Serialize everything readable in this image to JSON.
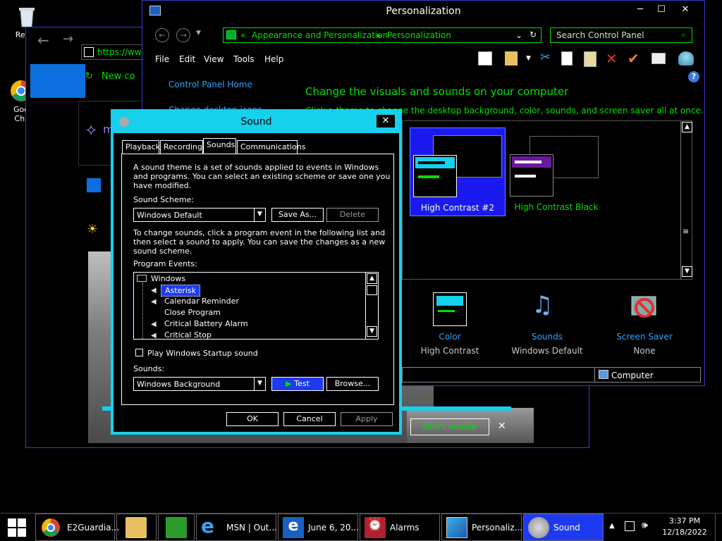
{
  "desktop": {
    "icons": [
      {
        "label": "Recyc",
        "icon": "recycle-bin-icon"
      },
      {
        "label": "Goo\nChr",
        "icon": "chrome-icon"
      }
    ]
  },
  "browser": {
    "url": "https://ww",
    "new_label": "New co",
    "bing_letter": "m",
    "dont_enable": "Don't enable",
    "close_glyph": "✕"
  },
  "personalization": {
    "title": "Personalization",
    "breadcrumb": [
      "Appearance and Personalization",
      "Personalization"
    ],
    "search_placeholder": "Search Control Panel",
    "menu": [
      "File",
      "Edit",
      "View",
      "Tools",
      "Help"
    ],
    "sidebar": {
      "home": "Control Panel Home",
      "desktop_icons": "Change desktop icons"
    },
    "heading": "Change the visuals and sounds on your computer",
    "subheading": "Click a theme to change the desktop background, color, sounds, and screen saver all at once.",
    "themes": [
      {
        "name": "High Contrast #2",
        "selected": true
      },
      {
        "name": "High Contrast Black",
        "selected": false
      }
    ],
    "bottom_items": [
      {
        "label": "Color",
        "value": "High Contrast",
        "icon": "color-icon"
      },
      {
        "label": "Sounds",
        "value": "Windows Default",
        "icon": "sounds-icon"
      },
      {
        "label": "Screen Saver",
        "value": "None",
        "icon": "screen-saver-icon"
      }
    ],
    "status": "Computer",
    "help_glyph": "?"
  },
  "sound": {
    "title": "Sound",
    "tabs": [
      "Playback",
      "Recording",
      "Sounds",
      "Communications"
    ],
    "active_tab": "Sounds",
    "intro": [
      "A sound theme is a set of sounds applied to events in Windows",
      "and programs.  You can select an existing scheme or save one you",
      "have modified."
    ],
    "scheme_label": "Sound Scheme:",
    "scheme_value": "Windows Default",
    "save_as": "Save As...",
    "delete": "Delete",
    "instructions": [
      "To change sounds, click a program event in the following list and",
      "then select a sound to apply.  You can save the changes as a new",
      "sound scheme."
    ],
    "events_label": "Program Events:",
    "events_group": "Windows",
    "events": [
      {
        "name": "Asterisk",
        "selected": true,
        "has_sound": true
      },
      {
        "name": "Calendar Reminder",
        "selected": false,
        "has_sound": true
      },
      {
        "name": "Close Program",
        "selected": false,
        "has_sound": false
      },
      {
        "name": "Critical Battery Alarm",
        "selected": false,
        "has_sound": true
      },
      {
        "name": "Critical Stop",
        "selected": false,
        "has_sound": true
      }
    ],
    "startup_label": "Play Windows Startup sound",
    "startup_checked": false,
    "sounds_label": "Sounds:",
    "sound_value": "Windows Background",
    "test": "Test",
    "browse": "Browse...",
    "ok": "OK",
    "cancel": "Cancel",
    "apply": "Apply"
  },
  "taskbar": {
    "items": [
      {
        "label": "E2Guardia...",
        "icon": "chrome-icon"
      },
      {
        "label": "",
        "icon": "file-explorer-icon"
      },
      {
        "label": "",
        "icon": "store-icon"
      },
      {
        "label": "MSN | Out...",
        "icon": "internet-explorer-icon"
      },
      {
        "label": "June 6, 20...",
        "icon": "internet-explorer-icon"
      },
      {
        "label": "Alarms",
        "icon": "alarms-icon"
      },
      {
        "label": "Personaliz...",
        "icon": "personalization-icon"
      },
      {
        "label": "Sound",
        "icon": "speaker-icon"
      }
    ],
    "time": "3:37 PM",
    "date": "12/18/2022"
  }
}
